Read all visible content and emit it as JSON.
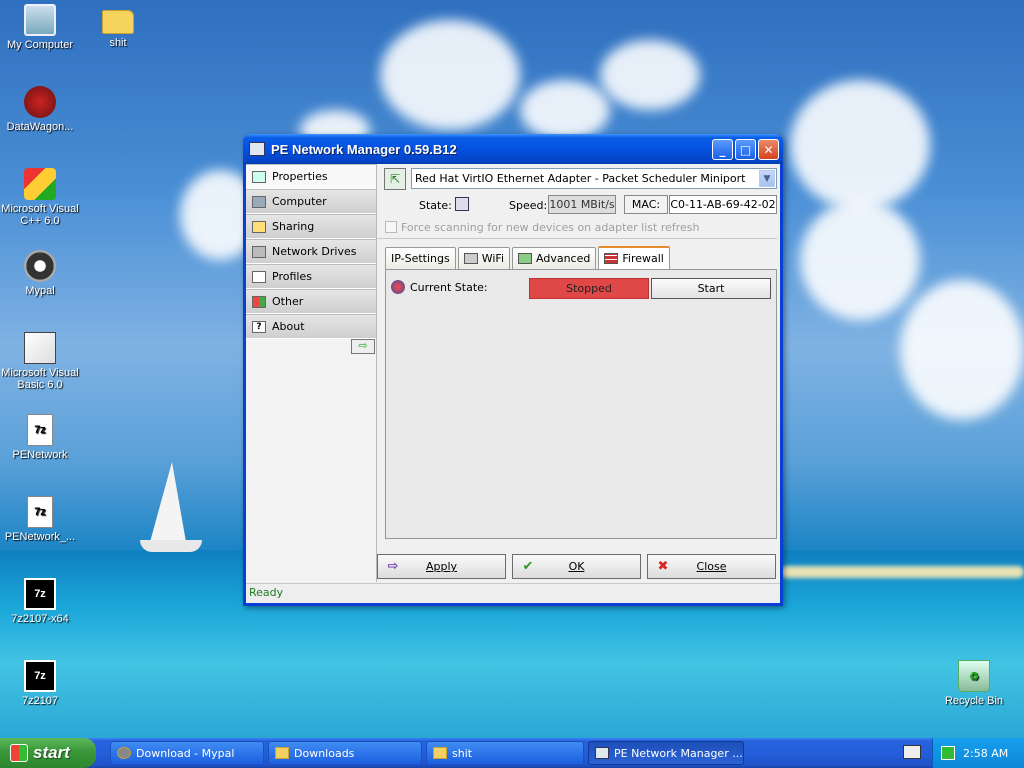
{
  "desktop": {
    "icons": [
      {
        "label": "My Computer",
        "glyph": "pc-icon"
      },
      {
        "label": "shit",
        "glyph": "folder-icon"
      },
      {
        "label": "DataWagon...",
        "glyph": "datawagon-icon"
      },
      {
        "label": "Microsoft Visual C++ 6.0",
        "glyph": "visual-cpp-icon"
      },
      {
        "label": "Mypal",
        "glyph": "mypal-icon"
      },
      {
        "label": "Microsoft Visual Basic 6.0",
        "glyph": "visual-basic-icon"
      },
      {
        "label": "PENetwork",
        "glyph": "7z-file-icon",
        "glyph_text": "7z"
      },
      {
        "label": "PENetwork_...",
        "glyph": "7z-file-icon",
        "glyph_text": "7z"
      },
      {
        "label": "7z2107-x64",
        "glyph": "7z-icon",
        "glyph_text": "7z"
      },
      {
        "label": "7z2107",
        "glyph": "7z-icon",
        "glyph_text": "7z"
      },
      {
        "label": "Recycle Bin",
        "glyph": "recycle-bin-icon"
      }
    ]
  },
  "window": {
    "title": "PE Network Manager 0.59.B12",
    "controls": {
      "minimize": "_",
      "maximize": "□",
      "close": "✕"
    },
    "nav": {
      "items": [
        {
          "label": "Properties",
          "icon": "properties-icon",
          "active": true
        },
        {
          "label": "Computer",
          "icon": "computer-icon"
        },
        {
          "label": "Sharing",
          "icon": "sharing-icon"
        },
        {
          "label": "Network Drives",
          "icon": "network-drives-icon"
        },
        {
          "label": "Profiles",
          "icon": "profiles-icon"
        },
        {
          "label": "Other",
          "icon": "other-icon"
        },
        {
          "label": "About",
          "icon": "about-icon",
          "icon_text": "?"
        }
      ],
      "collapse_glyph": "⇨"
    },
    "adapter": {
      "selected": "Red Hat VirtIO Ethernet Adapter - Packet Scheduler Miniport",
      "refresh_glyph": "⇱"
    },
    "status": {
      "state_label": "State:",
      "speed_label": "Speed:",
      "speed_value": "1001 MBit/s",
      "mac_label": "MAC:",
      "mac_value": "C0-11-AB-69-42-02"
    },
    "force_scan": {
      "label": "Force scanning for new devices on adapter list refresh",
      "checked": false,
      "enabled": false
    },
    "tabs": [
      {
        "label": "IP-Settings",
        "icon": ""
      },
      {
        "label": "WiFi",
        "icon": "wifi-icon"
      },
      {
        "label": "Advanced",
        "icon": "advanced-icon"
      },
      {
        "label": "Firewall",
        "icon": "firewall-icon",
        "active": true
      }
    ],
    "firewall": {
      "current_state_label": "Current State:",
      "state_value": "Stopped",
      "state_color": "#e04848",
      "start_button": "Start"
    },
    "buttons": {
      "apply": {
        "label": "Apply",
        "glyph": "⇨"
      },
      "ok": {
        "label": "OK",
        "glyph": "✔"
      },
      "close": {
        "label": "Close",
        "glyph": "✖"
      }
    },
    "statusbar": "Ready"
  },
  "taskbar": {
    "start_label": "start",
    "items": [
      {
        "label": "Download - Mypal",
        "icon": "mypal-icon"
      },
      {
        "label": "Downloads",
        "icon": "folder-icon"
      },
      {
        "label": "shit",
        "icon": "folder-icon"
      },
      {
        "label": "PE Network Manager ...",
        "icon": "pe-network-icon",
        "active": true
      }
    ],
    "clock": "2:58 AM"
  },
  "colors": {
    "titlebar": "#0551e0",
    "taskbar": "#245edb",
    "start_button": "#3c9a3c",
    "firewall_stopped": "#e04848",
    "status_ready": "#1f7a1f"
  }
}
